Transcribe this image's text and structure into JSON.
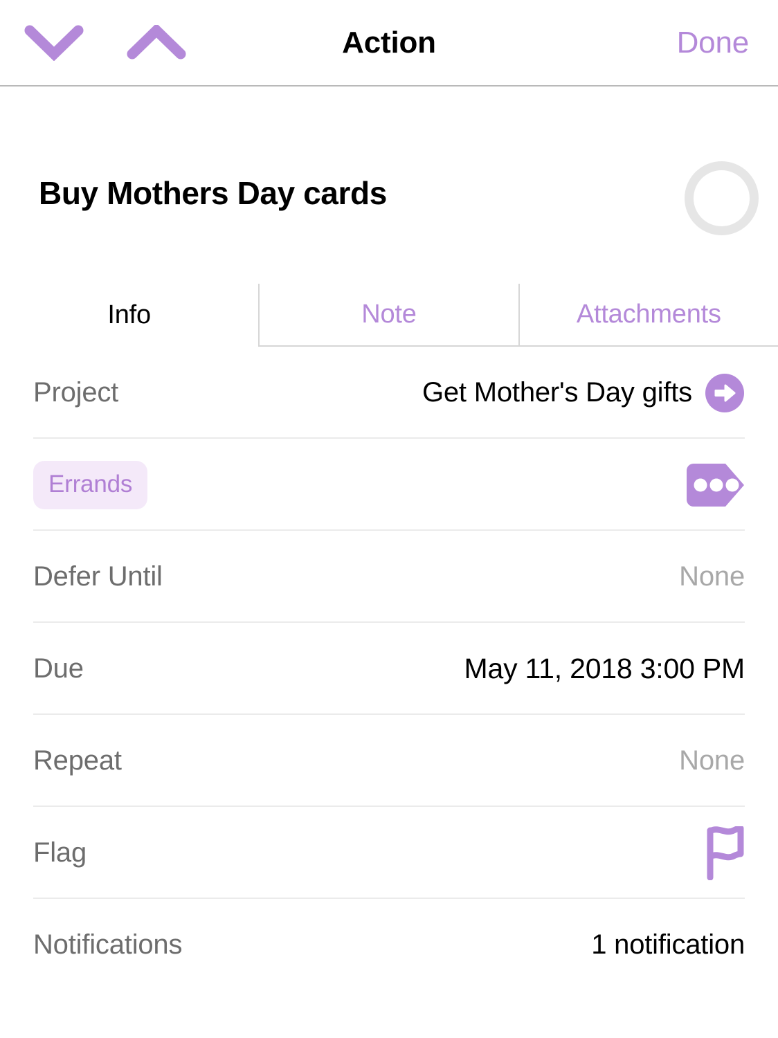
{
  "navbar": {
    "title": "Action",
    "done_label": "Done",
    "prev_icon": "chevron-down-icon",
    "next_icon": "chevron-up-icon"
  },
  "task": {
    "title": "Buy Mothers Day cards",
    "completed": false,
    "status_icon": "empty-circle-icon"
  },
  "tabs": [
    {
      "label": "Info",
      "active": true
    },
    {
      "label": "Note",
      "active": false
    },
    {
      "label": "Attachments",
      "active": false
    }
  ],
  "info": {
    "project": {
      "label": "Project",
      "value": "Get Mother's Day gifts",
      "accessory_icon": "arrow-right-circle-icon"
    },
    "tags": {
      "chip": "Errands",
      "accessory_icon": "tag-ellipsis-icon"
    },
    "defer_until": {
      "label": "Defer Until",
      "value": "None"
    },
    "due": {
      "label": "Due",
      "value": "May 11, 2018  3:00 PM"
    },
    "repeat": {
      "label": "Repeat",
      "value": "None"
    },
    "flag": {
      "label": "Flag",
      "accessory_icon": "flag-outline-icon"
    },
    "notifications": {
      "label": "Notifications",
      "value": "1 notification"
    }
  },
  "colors": {
    "accent_purple": "#b489d9",
    "tag_chip_bg": "#f4e9f9",
    "tag_chip_text": "#b07fd4",
    "separator": "#ebebeb",
    "navbar_border": "#b9b9b9",
    "status_ring": "#e6e6e6",
    "label_gray": "#6d6d6d",
    "muted_gray": "#a8a8a8"
  }
}
